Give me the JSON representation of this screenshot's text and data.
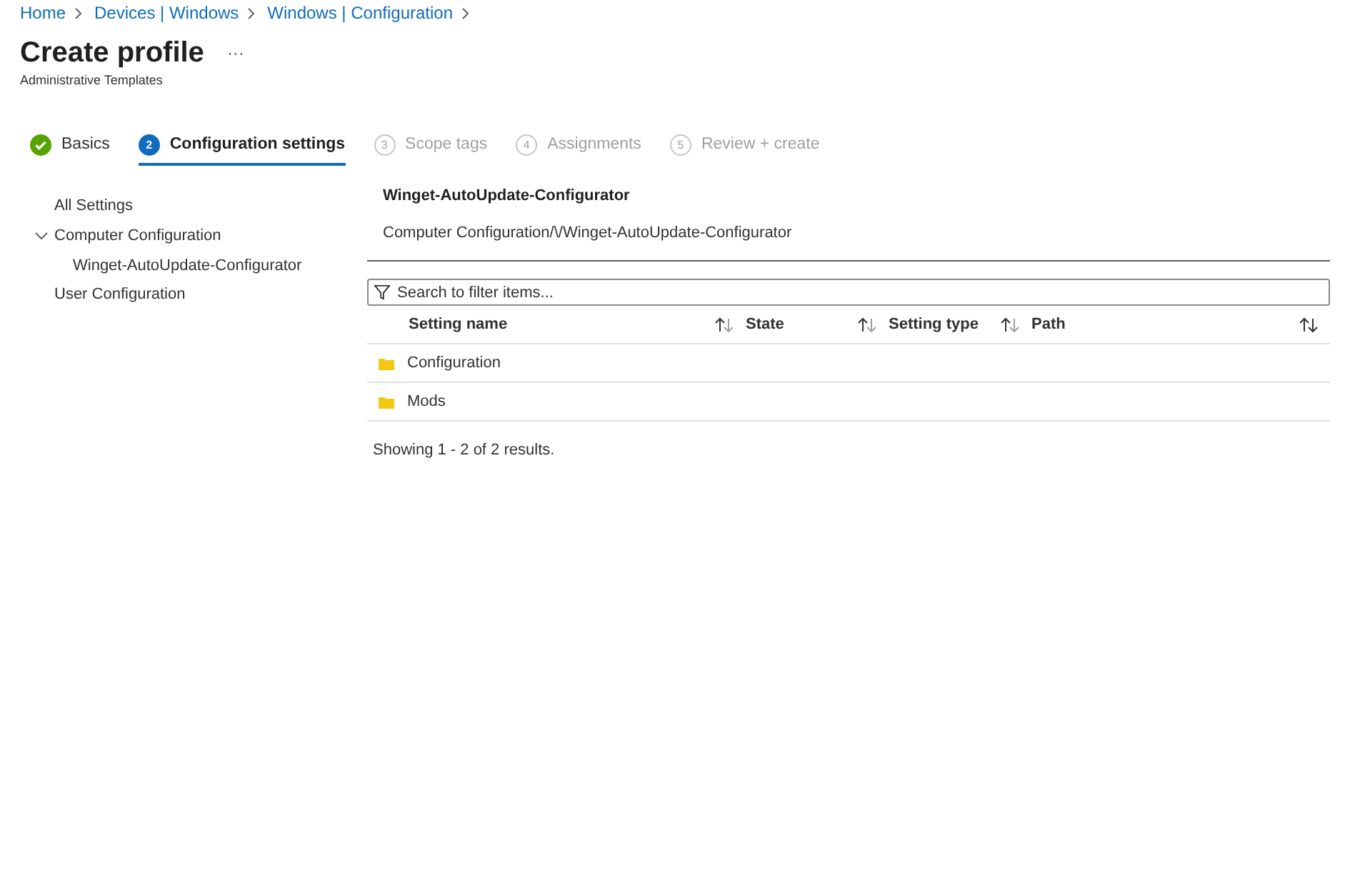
{
  "breadcrumb": [
    "Home",
    "Devices | Windows",
    "Windows | Configuration"
  ],
  "title": "Create profile",
  "more": "···",
  "subtitle": "Administrative Templates",
  "steps": [
    {
      "label": "Basics",
      "kind": "done",
      "selected": false
    },
    {
      "number": "2",
      "label": "Configuration settings",
      "kind": "current",
      "selected": true
    },
    {
      "number": "3",
      "label": "Scope tags",
      "kind": "pending",
      "selected": false
    },
    {
      "number": "4",
      "label": "Assignments",
      "kind": "pending",
      "selected": false
    },
    {
      "number": "5",
      "label": "Review + create",
      "kind": "pending",
      "selected": false
    }
  ],
  "tree": [
    {
      "label": "All Settings"
    },
    {
      "label": "Computer Configuration",
      "expanded": true,
      "children": [
        {
          "label": "Winget-AutoUpdate-Configurator"
        }
      ]
    },
    {
      "label": "User Configuration"
    }
  ],
  "section": {
    "title": "Winget-AutoUpdate-Configurator",
    "path": "Computer Configuration/\\/Winget-AutoUpdate-Configurator"
  },
  "search": {
    "placeholder": "Search to filter items..."
  },
  "table": {
    "columns": [
      "Setting name",
      "State",
      "Setting type",
      "Path"
    ],
    "rows": [
      {
        "name": "Configuration"
      },
      {
        "name": "Mods"
      }
    ]
  },
  "footer": "Showing 1 - 2 of 2 results."
}
